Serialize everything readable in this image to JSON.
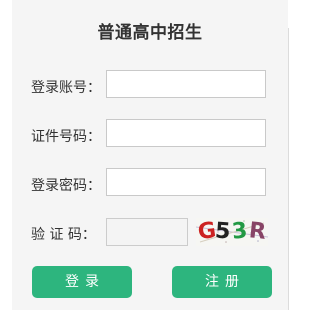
{
  "form": {
    "title": "普通高中招生",
    "fields": [
      {
        "label": "登录账号：",
        "value": ""
      },
      {
        "label": "证件号码：",
        "value": ""
      },
      {
        "label": "登录密码：",
        "value": ""
      }
    ],
    "captcha": {
      "label": "验 证 码：",
      "value": "",
      "image_chars": [
        "G",
        "5",
        "3",
        "R"
      ],
      "char_colors": [
        "#cc2222",
        "#222222",
        "#229944",
        "#884466"
      ]
    },
    "buttons": {
      "login_label": "登录",
      "register_label": "注册"
    }
  },
  "colors": {
    "accent": "#2db57e",
    "panel_bg": "#f5f5f5"
  }
}
